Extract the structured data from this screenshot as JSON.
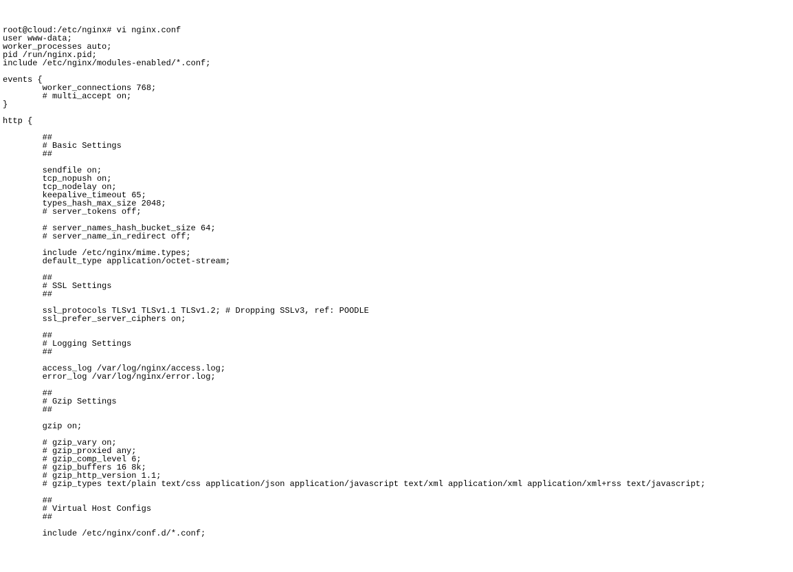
{
  "terminal": {
    "prompt_line": "root@cloud:/etc/nginx# vi nginx.conf",
    "lines": [
      "user www-data;",
      "worker_processes auto;",
      "pid /run/nginx.pid;",
      "include /etc/nginx/modules-enabled/*.conf;",
      "",
      "events {",
      "        worker_connections 768;",
      "        # multi_accept on;",
      "}",
      "",
      "http {",
      "",
      "        ##",
      "        # Basic Settings",
      "        ##",
      "",
      "        sendfile on;",
      "        tcp_nopush on;",
      "        tcp_nodelay on;",
      "        keepalive_timeout 65;",
      "        types_hash_max_size 2048;",
      "        # server_tokens off;",
      "",
      "        # server_names_hash_bucket_size 64;",
      "        # server_name_in_redirect off;",
      "",
      "        include /etc/nginx/mime.types;",
      "        default_type application/octet-stream;",
      "",
      "        ##",
      "        # SSL Settings",
      "        ##",
      "",
      "        ssl_protocols TLSv1 TLSv1.1 TLSv1.2; # Dropping SSLv3, ref: POODLE",
      "        ssl_prefer_server_ciphers on;",
      "",
      "        ##",
      "        # Logging Settings",
      "        ##",
      "",
      "        access_log /var/log/nginx/access.log;",
      "        error_log /var/log/nginx/error.log;",
      "",
      "        ##",
      "        # Gzip Settings",
      "        ##",
      "",
      "        gzip on;",
      "",
      "        # gzip_vary on;",
      "        # gzip_proxied any;",
      "        # gzip_comp_level 6;",
      "        # gzip_buffers 16 8k;",
      "        # gzip_http_version 1.1;",
      "        # gzip_types text/plain text/css application/json application/javascript text/xml application/xml application/xml+rss text/javascript;",
      "",
      "        ##",
      "        # Virtual Host Configs",
      "        ##",
      "",
      "        include /etc/nginx/conf.d/*.conf;"
    ]
  }
}
